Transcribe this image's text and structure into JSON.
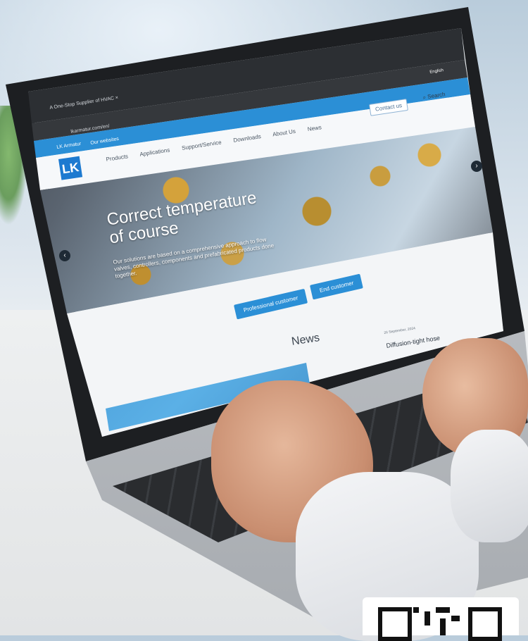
{
  "browser": {
    "tab_title": "A One-Stop Supplier of HVAC ×",
    "url": "lkarmatur.com/en/",
    "language": "English"
  },
  "site": {
    "topbar": {
      "brand_link": "LK Armatur",
      "websites_menu": "Our websites"
    },
    "contact_button": "Contact us",
    "search_label": "Search",
    "logo_text": "LK",
    "nav": [
      "Products",
      "Applications",
      "Support/Service",
      "Downloads",
      "About Us",
      "News"
    ],
    "hero": {
      "title_line1": "Correct temperature",
      "title_line2": "of course",
      "subtitle_line1": "Our solutions are based on a comprehensive approach to flow",
      "subtitle_line2": "valves, controllers, components and prefabricated products done",
      "subtitle_line3": "together."
    },
    "cta": {
      "professional": "Professional customer",
      "end": "End customer"
    },
    "news": {
      "heading": "News",
      "date": "26 September, 2024",
      "item_title": "Diffusion-tight hose"
    }
  },
  "colors": {
    "accent": "#2b8fd6",
    "logo": "#1d7ad0",
    "bezel": "#1d1f22"
  }
}
